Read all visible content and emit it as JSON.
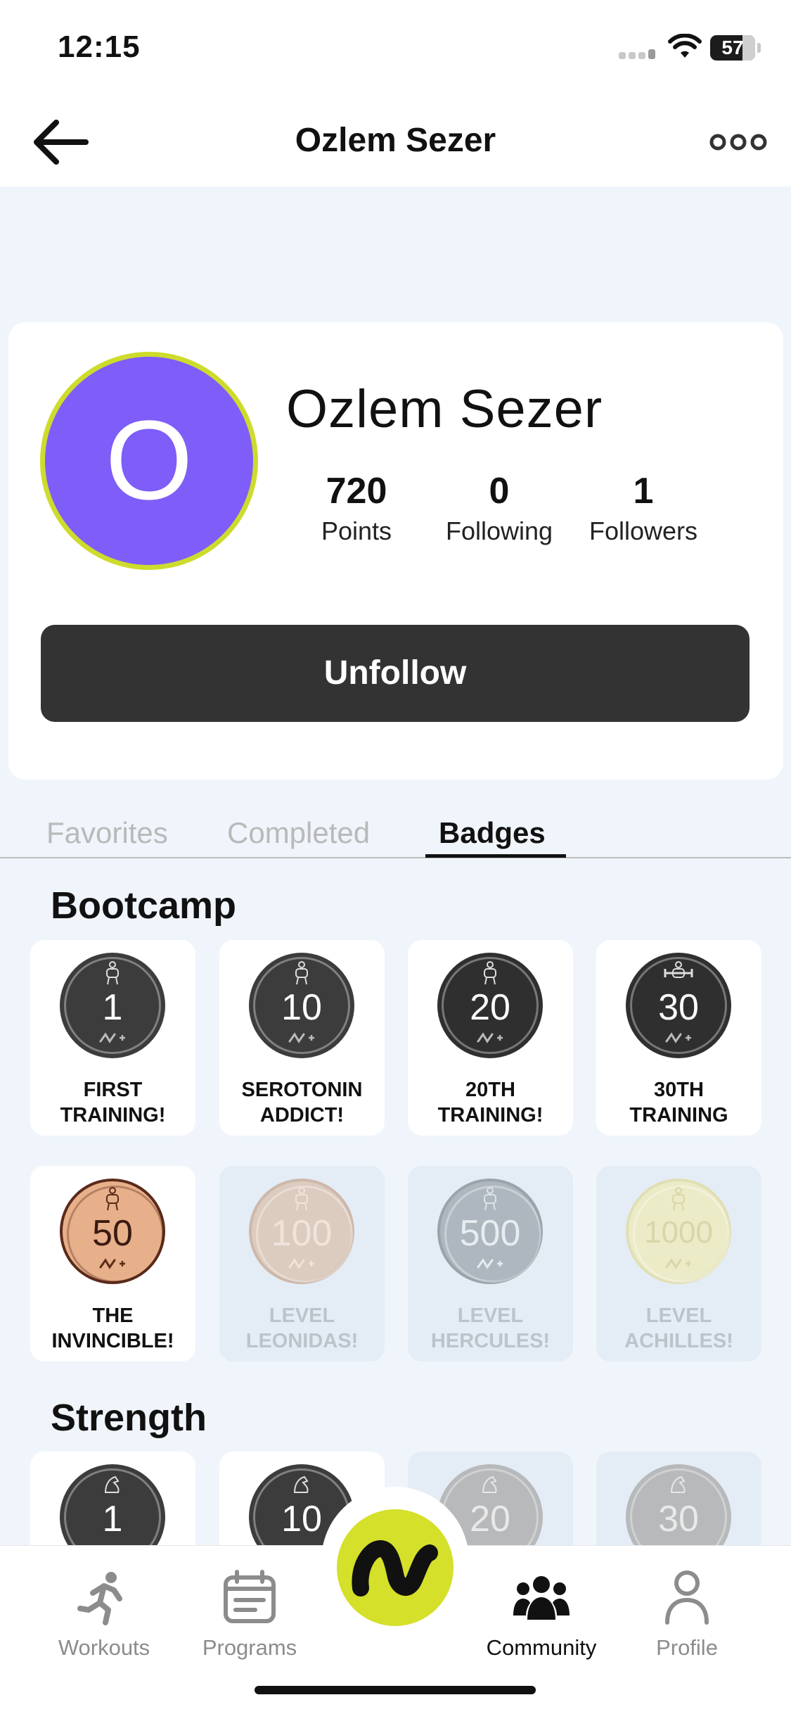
{
  "status_bar": {
    "time": "12:15",
    "battery": "57"
  },
  "header": {
    "title": "Ozlem Sezer"
  },
  "profile": {
    "avatar_letter": "O",
    "name": "Ozlem Sezer",
    "stats": [
      {
        "value": "720",
        "label": "Points"
      },
      {
        "value": "0",
        "label": "Following"
      },
      {
        "value": "1",
        "label": "Followers"
      }
    ],
    "unfollow_label": "Unfollow"
  },
  "tabs": [
    {
      "label": "Favorites",
      "active": false
    },
    {
      "label": "Completed",
      "active": false
    },
    {
      "label": "Badges",
      "active": true
    }
  ],
  "sections": [
    {
      "title": "Bootcamp",
      "badges": [
        {
          "number": "1",
          "label_line1": "FIRST",
          "label_line2": "TRAINING!",
          "earned": true
        },
        {
          "number": "10",
          "label_line1": "SEROTONIN",
          "label_line2": "ADDICT!",
          "earned": true
        },
        {
          "number": "20",
          "label_line1": "20TH",
          "label_line2": "TRAINING!",
          "earned": true
        },
        {
          "number": "30",
          "label_line1": "30TH",
          "label_line2": "TRAINING",
          "earned": true
        },
        {
          "number": "50",
          "label_line1": "THE",
          "label_line2": "INVINCIBLE!",
          "earned": true
        },
        {
          "number": "100",
          "label_line1": "LEVEL",
          "label_line2": "LEONIDAS!",
          "earned": false
        },
        {
          "number": "500",
          "label_line1": "LEVEL",
          "label_line2": "HERCULES!",
          "earned": false
        },
        {
          "number": "1000",
          "label_line1": "LEVEL",
          "label_line2": "ACHILLES!",
          "earned": false
        }
      ]
    },
    {
      "title": "Strength",
      "badges": [
        {
          "number": "1",
          "earned": true
        },
        {
          "number": "10",
          "earned": true
        },
        {
          "number": "20",
          "earned": false
        },
        {
          "number": "30",
          "earned": false
        }
      ]
    }
  ],
  "bottom_nav": [
    {
      "label": "Workouts",
      "icon": "running-person-icon",
      "active": false
    },
    {
      "label": "Programs",
      "icon": "calendar-icon",
      "active": false
    },
    {
      "label": "Community",
      "icon": "people-group-icon",
      "active": true
    },
    {
      "label": "Profile",
      "icon": "person-icon",
      "active": false
    }
  ],
  "colors": {
    "accent": "#d4e02a",
    "avatar_bg": "#7e5df8",
    "avatar_border": "#cddc2c",
    "button_dark": "#333333",
    "page_bg": "#eff5fb",
    "medal_dark": "#3c3c3c",
    "medal_bronze": "#e8b08a",
    "medal_locked_bronze": "#dccbbf",
    "medal_locked_silver": "#aeb7bf",
    "medal_locked_gold": "#ecebc8"
  }
}
